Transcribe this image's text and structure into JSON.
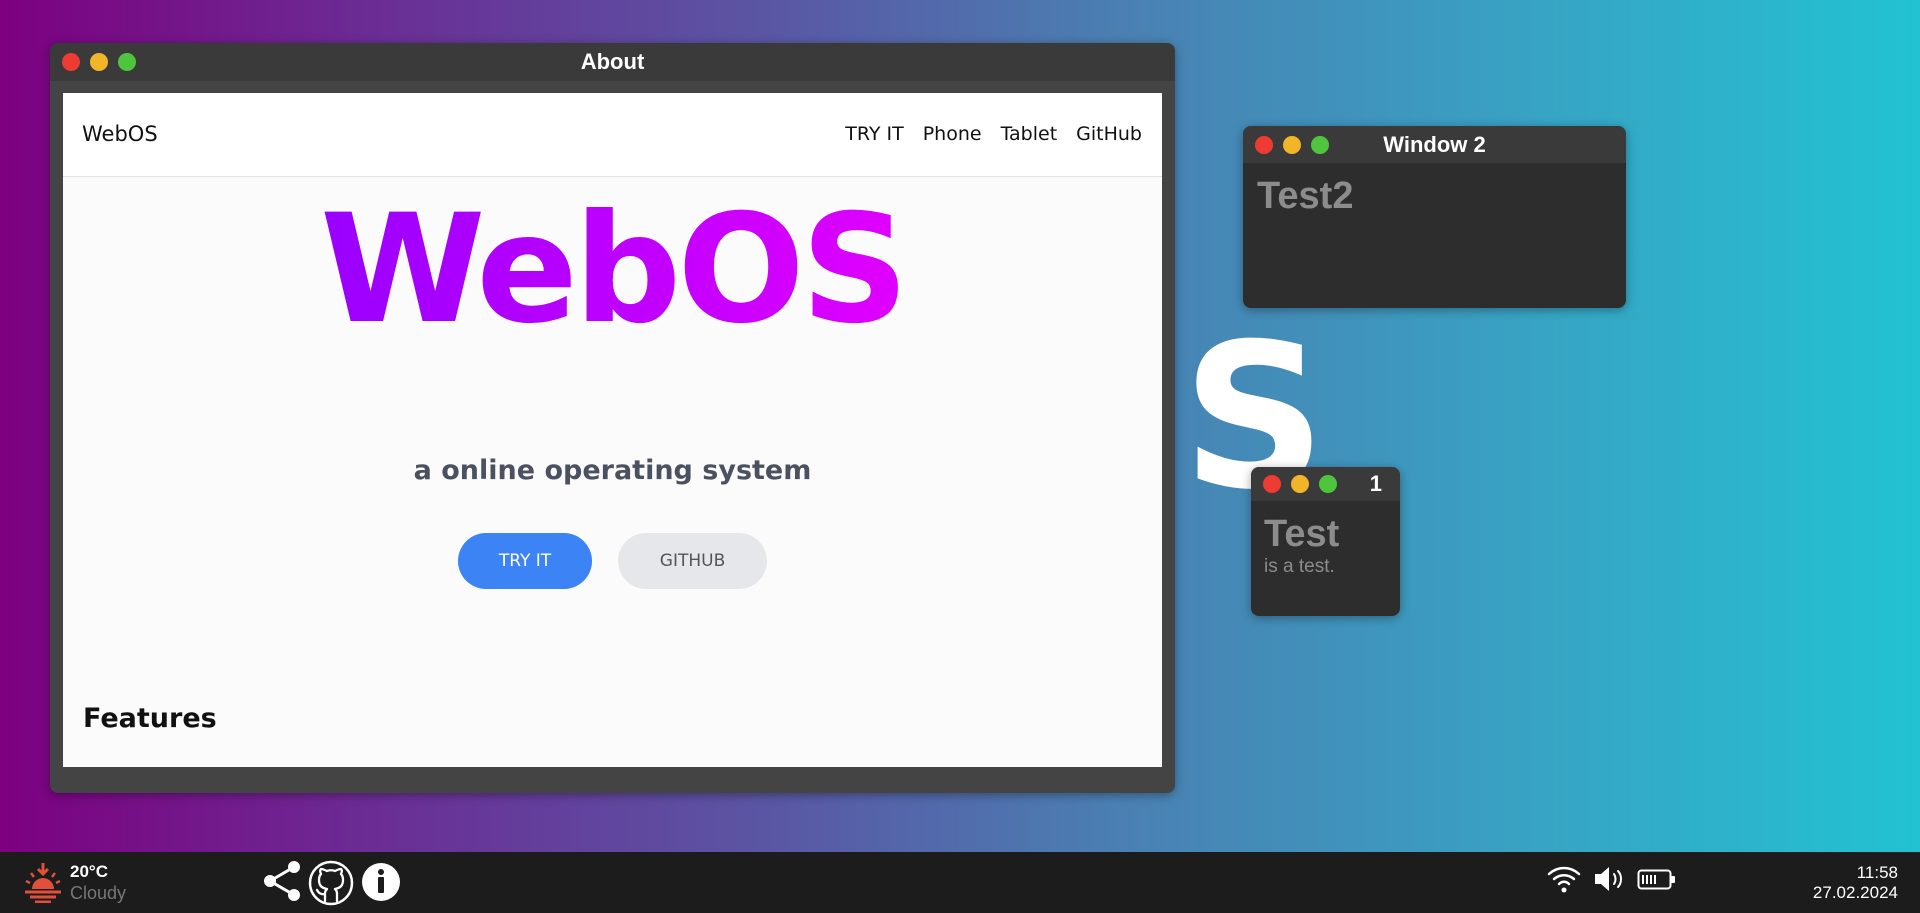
{
  "desktop": {
    "background_letter": "S"
  },
  "windows": {
    "about": {
      "title": "About",
      "page": {
        "brand": "WebOS",
        "nav": [
          "TRY IT",
          "Phone",
          "Tablet",
          "GitHub"
        ],
        "hero_title": "WebOS",
        "hero_subtitle": "a online operating system",
        "buttons": {
          "try": "TRY IT",
          "github": "GITHUB"
        },
        "section_heading": "Features"
      }
    },
    "window2": {
      "title": "Window 2",
      "heading": "Test2"
    },
    "window1": {
      "title": "1",
      "heading": "Test",
      "body": "is a test."
    }
  },
  "taskbar": {
    "weather": {
      "temp": "20°C",
      "condition": "Cloudy",
      "icon": "sunset-icon"
    },
    "apps": [
      "share-icon",
      "github-icon",
      "info-icon"
    ],
    "tray": [
      "wifi-icon",
      "volume-icon",
      "battery-icon"
    ],
    "clock": {
      "time": "11:58",
      "date": "27.02.2024"
    }
  },
  "colors": {
    "accent_blue": "#3c83f6",
    "hero_gradient_start": "#7a00ff",
    "hero_gradient_end": "#ff00ff",
    "close": "#ee3b34",
    "minimize": "#f0b529",
    "maximize": "#4ec53d"
  }
}
